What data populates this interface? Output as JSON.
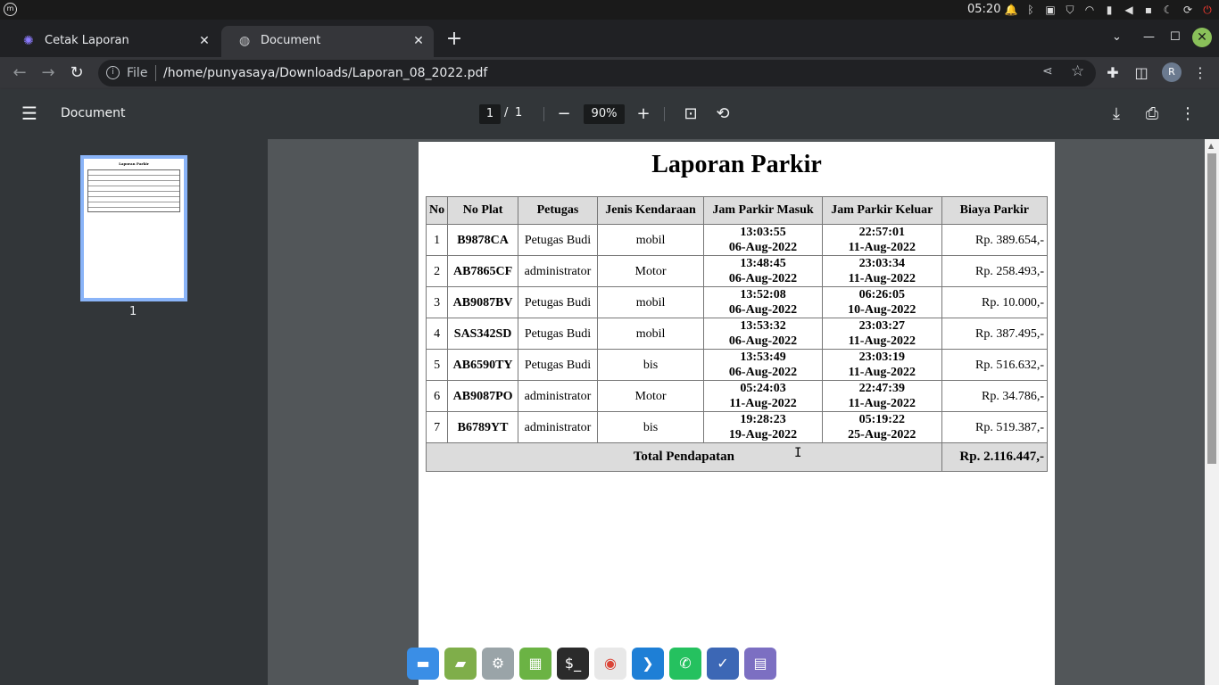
{
  "system": {
    "clock": "05:20"
  },
  "browser": {
    "tabs": [
      {
        "title": "Cetak Laporan",
        "icon": "gear-icon"
      },
      {
        "title": "Document",
        "icon": "globe-icon"
      }
    ],
    "address": {
      "scheme": "File",
      "url": "/home/punyasaya/Downloads/Laporan_08_2022.pdf"
    },
    "profile_initial": "R"
  },
  "pdf_viewer": {
    "title": "Document",
    "current_page": "1",
    "page_separator": "/",
    "total_pages": "1",
    "zoom": "90%",
    "thumbnail_label": "1",
    "thumbnail_title": "Laporan Parkir"
  },
  "report": {
    "title": "Laporan Parkir",
    "headers": [
      "No",
      "No Plat",
      "Petugas",
      "Jenis Kendaraan",
      "Jam Parkir Masuk",
      "Jam Parkir Keluar",
      "Biaya Parkir"
    ],
    "rows": [
      {
        "no": "1",
        "plat": "B9878CA",
        "petugas": "Petugas Budi",
        "jenis": "mobil",
        "masuk_time": "13:03:55",
        "masuk_date": "06-Aug-2022",
        "keluar_time": "22:57:01",
        "keluar_date": "11-Aug-2022",
        "biaya": "Rp. 389.654,-"
      },
      {
        "no": "2",
        "plat": "AB7865CF",
        "petugas": "administrator",
        "jenis": "Motor",
        "masuk_time": "13:48:45",
        "masuk_date": "06-Aug-2022",
        "keluar_time": "23:03:34",
        "keluar_date": "11-Aug-2022",
        "biaya": "Rp. 258.493,-"
      },
      {
        "no": "3",
        "plat": "AB9087BV",
        "petugas": "Petugas Budi",
        "jenis": "mobil",
        "masuk_time": "13:52:08",
        "masuk_date": "06-Aug-2022",
        "keluar_time": "06:26:05",
        "keluar_date": "10-Aug-2022",
        "biaya": "Rp. 10.000,-"
      },
      {
        "no": "4",
        "plat": "SAS342SD",
        "petugas": "Petugas Budi",
        "jenis": "mobil",
        "masuk_time": "13:53:32",
        "masuk_date": "06-Aug-2022",
        "keluar_time": "23:03:27",
        "keluar_date": "11-Aug-2022",
        "biaya": "Rp. 387.495,-"
      },
      {
        "no": "5",
        "plat": "AB6590TY",
        "petugas": "Petugas Budi",
        "jenis": "bis",
        "masuk_time": "13:53:49",
        "masuk_date": "06-Aug-2022",
        "keluar_time": "23:03:19",
        "keluar_date": "11-Aug-2022",
        "biaya": "Rp. 516.632,-"
      },
      {
        "no": "6",
        "plat": "AB9087PO",
        "petugas": "administrator",
        "jenis": "Motor",
        "masuk_time": "05:24:03",
        "masuk_date": "11-Aug-2022",
        "keluar_time": "22:47:39",
        "keluar_date": "11-Aug-2022",
        "biaya": "Rp. 34.786,-"
      },
      {
        "no": "7",
        "plat": "B6789YT",
        "petugas": "administrator",
        "jenis": "bis",
        "masuk_time": "19:28:23",
        "masuk_date": "19-Aug-2022",
        "keluar_time": "05:19:22",
        "keluar_date": "25-Aug-2022",
        "biaya": "Rp. 519.387,-"
      }
    ],
    "total_label": "Total Pendapatan",
    "total_value": "Rp. 2.116.447,-"
  },
  "colors": {
    "thumbnail_border": "#8ab4f8",
    "table_header_bg": "#dcdcdc",
    "window_close": "#8ac05a",
    "power_icon": "#ff3b30"
  }
}
